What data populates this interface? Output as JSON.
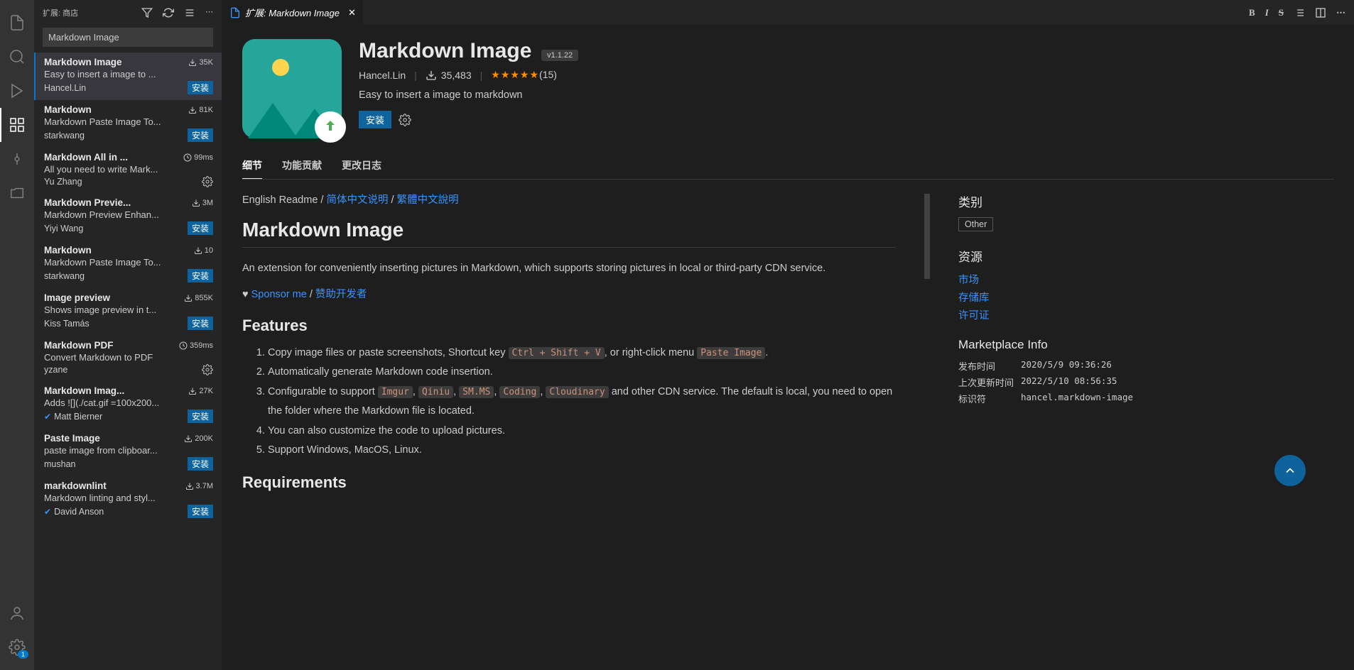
{
  "sidebar": {
    "title": "扩展: 商店",
    "search_value": "Markdown Image",
    "install_label": "安装",
    "items": [
      {
        "name": "Markdown Image",
        "stat_icon": "download",
        "stat": "35K",
        "desc": "Easy to insert a image to ...",
        "author": "Hancel.Lin",
        "action": "install",
        "selected": true,
        "verified": false
      },
      {
        "name": "Markdown",
        "stat_icon": "download",
        "stat": "81K",
        "desc": "Markdown Paste Image To...",
        "author": "starkwang",
        "action": "install",
        "selected": false,
        "verified": false
      },
      {
        "name": "Markdown All in ...",
        "stat_icon": "clock",
        "stat": "99ms",
        "desc": "All you need to write Mark...",
        "author": "Yu Zhang",
        "action": "gear",
        "selected": false,
        "verified": false
      },
      {
        "name": "Markdown Previe...",
        "stat_icon": "download",
        "stat": "3M",
        "desc": "Markdown Preview Enhan...",
        "author": "Yiyi Wang",
        "action": "install",
        "selected": false,
        "verified": false
      },
      {
        "name": "Markdown",
        "stat_icon": "download",
        "stat": "10",
        "desc": "Markdown Paste Image To...",
        "author": "starkwang",
        "action": "install",
        "selected": false,
        "verified": false
      },
      {
        "name": "Image preview",
        "stat_icon": "download",
        "stat": "855K",
        "desc": "Shows image preview in t...",
        "author": "Kiss Tamás",
        "action": "install",
        "selected": false,
        "verified": false
      },
      {
        "name": "Markdown PDF",
        "stat_icon": "clock",
        "stat": "359ms",
        "desc": "Convert Markdown to PDF",
        "author": "yzane",
        "action": "gear",
        "selected": false,
        "verified": false
      },
      {
        "name": "Markdown Imag...",
        "stat_icon": "download",
        "stat": "27K",
        "desc": "Adds ![](./cat.gif =100x200...",
        "author": "Matt Bierner",
        "action": "install",
        "selected": false,
        "verified": true
      },
      {
        "name": "Paste Image",
        "stat_icon": "download",
        "stat": "200K",
        "desc": "paste image from clipboar...",
        "author": "mushan",
        "action": "install",
        "selected": false,
        "verified": false
      },
      {
        "name": "markdownlint",
        "stat_icon": "download",
        "stat": "3.7M",
        "desc": "Markdown linting and styl...",
        "author": "David Anson",
        "action": "install",
        "selected": false,
        "verified": true
      }
    ]
  },
  "tab": {
    "title": "扩展: Markdown Image"
  },
  "ext": {
    "title": "Markdown Image",
    "version": "v1.1.22",
    "publisher": "Hancel.Lin",
    "installs": "35,483",
    "rating_count": "(15)",
    "subtitle": "Easy to insert a image to markdown",
    "install_label": "安装"
  },
  "detail_tabs": {
    "details": "细节",
    "contrib": "功能贡献",
    "changelog": "更改日志"
  },
  "readme": {
    "lang_en": "English Readme",
    "lang_sc": "简体中文说明",
    "lang_tc": "繁體中文說明",
    "h1": "Markdown Image",
    "intro": "An extension for conveniently inserting pictures in Markdown, which supports storing pictures in local or third-party CDN service.",
    "sponsor": "Sponsor me",
    "sponsor_cn": "赞助开发者",
    "features_h": "Features",
    "f1a": "Copy image files or paste screenshots, Shortcut key ",
    "f1_code1": "Ctrl + Shift + V",
    "f1b": ", or right-click menu ",
    "f1_code2": "Paste Image",
    "f1c": ".",
    "f2": "Automatically generate Markdown code insertion.",
    "f3a": "Configurable to support ",
    "f3_c1": "Imgur",
    "f3_c2": "Qiniu",
    "f3_c3": "SM.MS",
    "f3_c4": "Coding",
    "f3_c5": "Cloudinary",
    "f3b": " and other CDN service. The default is local, you need to open the folder where the Markdown file is located.",
    "f4": "You can also customize the code to upload pictures.",
    "f5": "Support Windows, MacOS, Linux.",
    "req_h": "Requirements"
  },
  "side": {
    "cat_h": "类别",
    "cat": "Other",
    "res_h": "资源",
    "res_market": "市场",
    "res_repo": "存储库",
    "res_license": "许可证",
    "mp_h": "Marketplace Info",
    "pub_l": "发布时间",
    "pub_v": "2020/5/9 09:36:26",
    "upd_l": "上次更新时间",
    "upd_v": "2022/5/10 08:56:35",
    "id_l": "标识符",
    "id_v": "hancel.markdown-image"
  },
  "badge_count": "1"
}
